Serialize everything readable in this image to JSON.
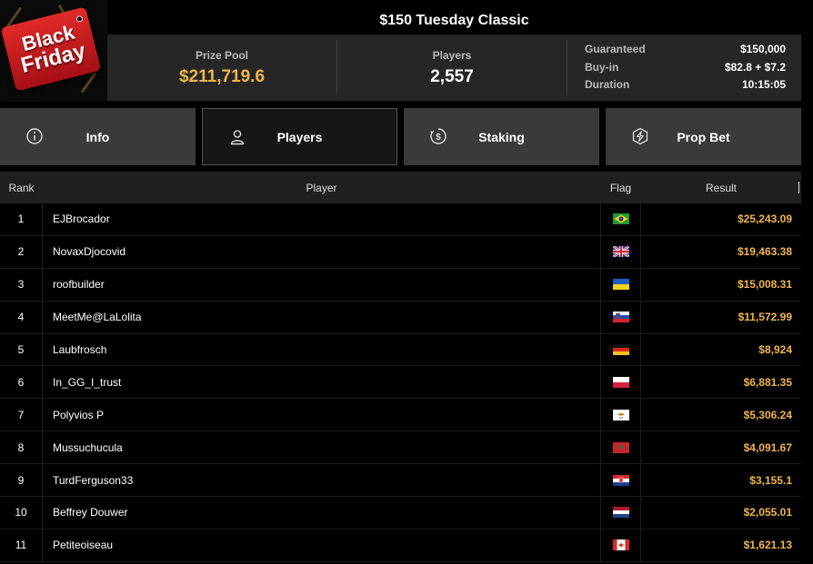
{
  "logo": {
    "line1": "Black",
    "line2": "Friday"
  },
  "tournament": {
    "title": "$150 Tuesday Classic"
  },
  "stats": {
    "prize_pool_label": "Prize Pool",
    "prize_pool_value": "$211,719.6",
    "players_label": "Players",
    "players_value": "2,557",
    "guaranteed_label": "Guaranteed",
    "guaranteed_value": "$150,000",
    "buyin_label": "Buy-in",
    "buyin_value": "$82.8 + $7.2",
    "duration_label": "Duration",
    "duration_value": "10:15:05"
  },
  "tabs": [
    {
      "label": "Info",
      "icon": "info-icon",
      "active": false
    },
    {
      "label": "Players",
      "icon": "user-icon",
      "active": true
    },
    {
      "label": "Staking",
      "icon": "dollar-coin-icon",
      "active": false
    },
    {
      "label": "Prop Bet",
      "icon": "lightning-shield-icon",
      "active": false
    }
  ],
  "table": {
    "headers": {
      "rank": "Rank",
      "player": "Player",
      "flag": "Flag",
      "result": "Result"
    },
    "rows": [
      {
        "rank": "1",
        "player": "EJBrocador",
        "flag": "brazil",
        "result": "$25,243.09"
      },
      {
        "rank": "2",
        "player": "NovaxDjocovid",
        "flag": "united-kingdom",
        "result": "$19,463.38"
      },
      {
        "rank": "3",
        "player": "roofbuilder",
        "flag": "ukraine",
        "result": "$15,008.31"
      },
      {
        "rank": "4",
        "player": "MeetMe@LaLolita",
        "flag": "slovenia",
        "result": "$11,572.99"
      },
      {
        "rank": "5",
        "player": "Laubfrosch",
        "flag": "germany",
        "result": "$8,924"
      },
      {
        "rank": "6",
        "player": "In_GG_I_trust",
        "flag": "poland",
        "result": "$6,881.35"
      },
      {
        "rank": "7",
        "player": "Polyvios P",
        "flag": "cyprus",
        "result": "$5,306.24"
      },
      {
        "rank": "8",
        "player": "Mussuchucula",
        "flag": "morocco",
        "result": "$4,091.67"
      },
      {
        "rank": "9",
        "player": "TurdFerguson33",
        "flag": "croatia",
        "result": "$3,155.1"
      },
      {
        "rank": "10",
        "player": "Beffrey Douwer",
        "flag": "netherlands",
        "result": "$2,055.01"
      },
      {
        "rank": "11",
        "player": "Petiteoiseau",
        "flag": "canada",
        "result": "$1,621.13"
      }
    ]
  },
  "colors": {
    "gold": "#f0b64a",
    "tab_bg": "#3a3a3a",
    "tab_active_bg": "#161616",
    "panel_bg": "#262626"
  }
}
